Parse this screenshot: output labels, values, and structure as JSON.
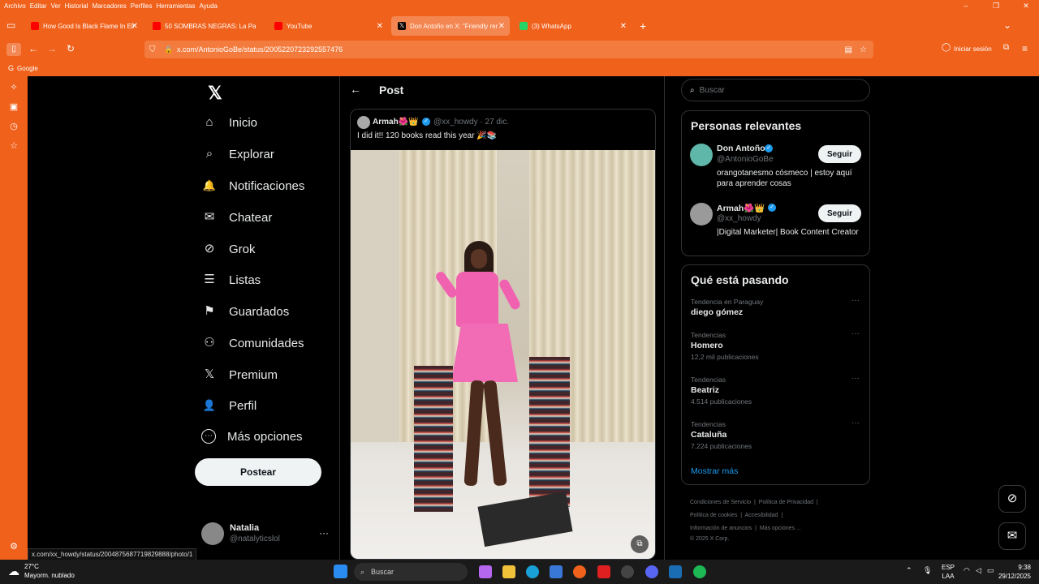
{
  "browser": {
    "menu": [
      "Archivo",
      "Editar",
      "Ver",
      "Historial",
      "Marcadores",
      "Perfiles",
      "Herramientas",
      "Ayuda"
    ],
    "tabs": [
      {
        "label": "How Good Is Black Flame In Eld",
        "color": "#ff0000"
      },
      {
        "label": "50 SOMBRAS NEGRAS: La Paro",
        "color": "#ff0000"
      },
      {
        "label": "YouTube",
        "color": "#ff0000"
      },
      {
        "label": "Don Antoño en X: \"Friendly rem",
        "color": "#000000"
      },
      {
        "label": "(3) WhatsApp",
        "color": "#25d366"
      }
    ],
    "new_tab": "+",
    "url": "x.com/AntonioGoBe/status/2005220723292557476",
    "signin": "Iniciar sesión",
    "bookmark": "Google",
    "status_url": "x.com/xx_howdy/status/2004875687719829888/photo/1"
  },
  "nav": {
    "items": [
      {
        "label": "Inicio",
        "icon": "⌂"
      },
      {
        "label": "Explorar",
        "icon": "⌕"
      },
      {
        "label": "Notificaciones",
        "icon": "🔔"
      },
      {
        "label": "Chatear",
        "icon": "✉"
      },
      {
        "label": "Grok",
        "icon": "⊘"
      },
      {
        "label": "Listas",
        "icon": "☰"
      },
      {
        "label": "Guardados",
        "icon": "⚑"
      },
      {
        "label": "Comunidades",
        "icon": "⚇"
      },
      {
        "label": "Premium",
        "icon": "𝕏"
      },
      {
        "label": "Perfil",
        "icon": "👤"
      },
      {
        "label": "Más opciones",
        "icon": "⋯"
      }
    ],
    "post_button": "Postear",
    "account_name": "Natalia",
    "account_handle": "@natalyticslol"
  },
  "post": {
    "header": "Post",
    "author": "Armah🌺👑",
    "handle_date": "@xx_howdy · 27 dic.",
    "text": "I did it!! 120 books read this year 🎉📚"
  },
  "right": {
    "search_placeholder": "Buscar",
    "relevant_title": "Personas relevantes",
    "people": [
      {
        "name": "Don Antoño",
        "handle": "@AntonioGoBe",
        "bio": "orangotanesmo cósmeco | estoy aquí para aprender cosas",
        "follow": "Seguir"
      },
      {
        "name": "Armah🌺👑",
        "handle": "@xx_howdy",
        "bio": "|Digital Marketer| Book Content Creator",
        "follow": "Seguir"
      }
    ],
    "trends_title": "Qué está pasando",
    "trends": [
      {
        "context": "Tendencia en Paraguay",
        "name": "diego gómez",
        "posts": ""
      },
      {
        "context": "Tendencias",
        "name": "Homero",
        "posts": "12,2 mil publicaciones"
      },
      {
        "context": "Tendencias",
        "name": "Beatriz",
        "posts": "4.514 publicaciones"
      },
      {
        "context": "Tendencias",
        "name": "Cataluña",
        "posts": "7.224 publicaciones"
      }
    ],
    "show_more": "Mostrar más",
    "footer": {
      "l1a": "Condiciones de Servicio",
      "l1b": "Política de Privacidad",
      "l2a": "Política de cookies",
      "l2b": "Accesibilidad",
      "l3a": "Información de anuncios",
      "l3b": "Más opciones ...",
      "l4": "© 2025 X Corp."
    }
  },
  "taskbar": {
    "temp": "27°C",
    "weather": "Mayorm. nublado",
    "search": "Buscar",
    "lang1": "ESP",
    "lang2": "LAA",
    "time": "9:38",
    "date": "29/12/2025"
  }
}
